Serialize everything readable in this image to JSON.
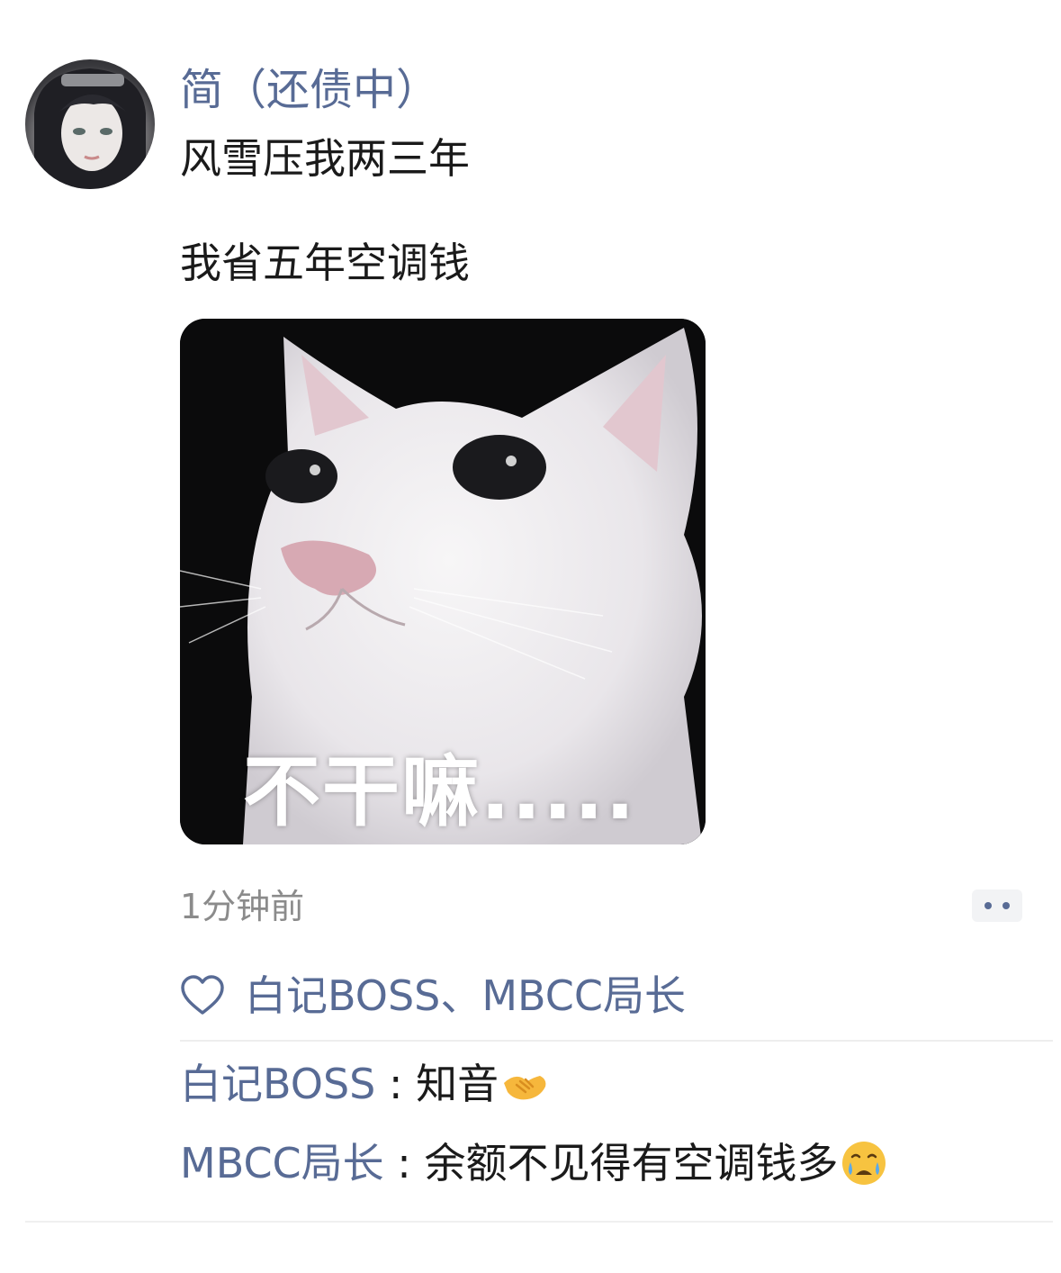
{
  "post": {
    "author": "简（还债中）",
    "text_line_1": "风雪压我两三年",
    "text_line_2": "我省五年空调钱",
    "image_caption": "不干嘛.....",
    "timestamp": "1分钟前"
  },
  "likes": {
    "names": "白记BOSS、MBCC局长"
  },
  "comments": [
    {
      "author": "白记BOSS",
      "separator": " : ",
      "text": "知音",
      "emoji": "handshake-emoji"
    },
    {
      "author": "MBCC局长",
      "separator": " : ",
      "text": "余额不见得有空调钱多",
      "emoji": "crying-worried-face-emoji"
    }
  ],
  "colors": {
    "link_blue": "#586b95",
    "text": "#1a1a1a",
    "muted": "#8b8b8b"
  }
}
